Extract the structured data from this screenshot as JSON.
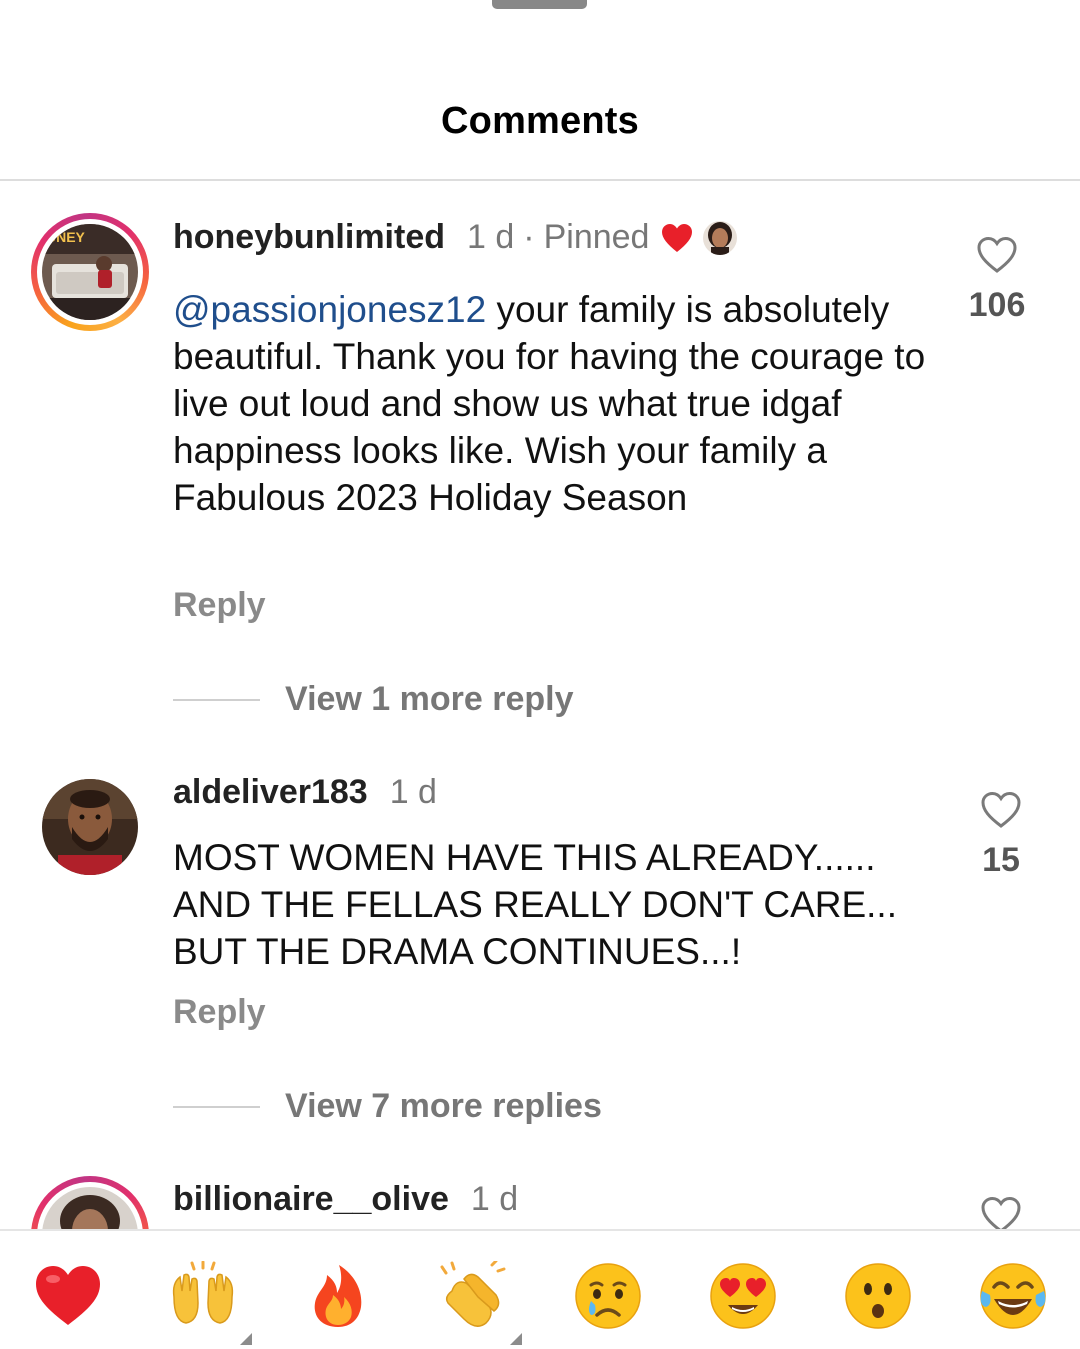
{
  "sheet": {
    "title": "Comments"
  },
  "comments": [
    {
      "username": "honeybunlimited",
      "time": "1 d",
      "separator": "·",
      "pinned": "Pinned",
      "mention": "@passionjonesz12",
      "text": " your family is absolutely beautiful. Thank you for having the courage to live out loud and show us what true idgaf happiness looks like. Wish your family a Fabulous 2023 Holiday Season",
      "reply_label": "Reply",
      "view_more": "View 1 more reply",
      "likes": "106"
    },
    {
      "username": "aldeliver183",
      "time": "1 d",
      "text": "MOST WOMEN HAVE THIS ALREADY......\nAND THE FELLAS REALLY DON'T CARE...\nBUT THE DRAMA CONTINUES...!",
      "line1": "MOST WOMEN HAVE THIS ALREADY......",
      "line2": "AND THE FELLAS REALLY DON'T CARE...",
      "line3": "BUT THE DRAMA CONTINUES...!",
      "reply_label": "Reply",
      "view_more": "View 7 more replies",
      "likes": "15"
    },
    {
      "username": "billionaire__olive",
      "time": "1 d"
    }
  ],
  "emoji_bar": {
    "items": [
      "heart-emoji",
      "raising-hands-emoji",
      "fire-emoji",
      "clapping-hands-emoji",
      "crying-face-emoji",
      "heart-eyes-emoji",
      "surprised-face-emoji",
      "tears-of-joy-emoji"
    ]
  },
  "colors": {
    "mention": "#1f4e8c",
    "heart_red": "#e8202a",
    "muted_text": "#777777"
  }
}
